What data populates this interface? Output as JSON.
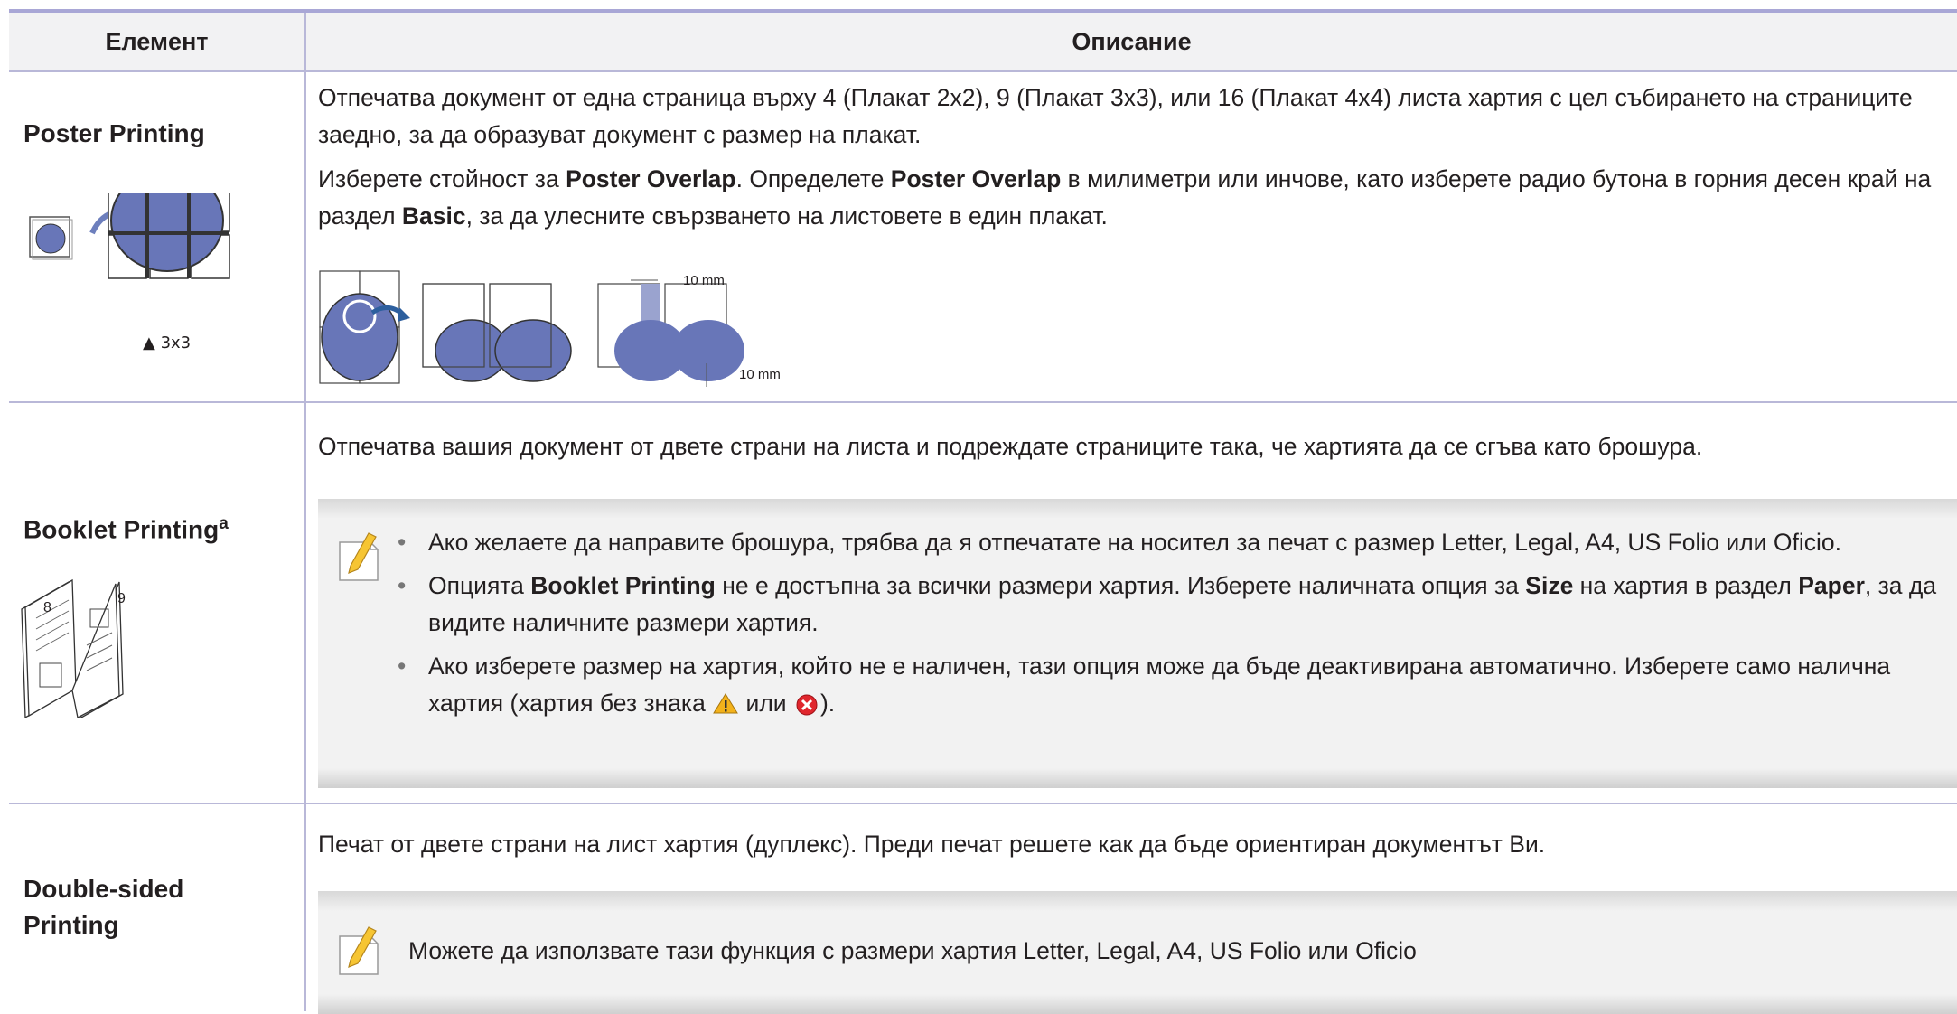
{
  "header": {
    "col1": "Елемент",
    "col2": "Описание"
  },
  "rows": [
    {
      "label": "Poster Printing",
      "illustration_caption": "▲ 3x3",
      "para1": "Отпечатва документ от една страница върху 4 (Плакат 2x2), 9 (Плакат 3x3), или 16 (Плакат 4x4) листа хартия с цел събирането на страниците заедно, за да образуват документ с размер на плакат.",
      "para2_a": "Изберете стойност за ",
      "para2_b": "Poster Overlap",
      "para2_c": ". Определете ",
      "para2_d": "Poster Overlap",
      "para2_e": " в милиметри или инчове, като изберете радио бутона в горния десен край на раздел ",
      "para2_f": "Basic",
      "para2_g": ", за да улесните свързването на листовете в един плакат.",
      "overlap_h": "10 mm",
      "overlap_v": "10 mm"
    },
    {
      "label": "Booklet Printing",
      "label_sup": "a",
      "para1": "Отпечатва вашия документ от двете страни на листа и подреждате страниците така, че хартията да се сгъва като брошура.",
      "bullet1": "Ако желаете да направите брошура, трябва да я отпечатате на носител за печат с размер Letter, Legal, A4, US Folio или Oficio.",
      "bullet2_a": "Опцията ",
      "bullet2_b": "Booklet Printing",
      "bullet2_c": " не е достъпна за всички размери хартия. Изберете наличната опция за ",
      "bullet2_d": "Size",
      "bullet2_e": " на хартия в раздел ",
      "bullet2_f": "Paper",
      "bullet2_g": ", за да видите наличните размери хартия.",
      "bullet3_a": "Ако изберете размер на хартия, който не е наличен, тази опция може да бъде деактивирана автоматично. Изберете само налична хартия (хартия без знака ",
      "bullet3_b": " или ",
      "bullet3_c": ").",
      "book_page_left": "8",
      "book_page_right": "9"
    },
    {
      "label": "Double-sided Printing",
      "para1": "Печат от двете страни на лист хартия (дуплекс). Преди печат решете как да бъде ориентиран документът Ви.",
      "note": "Можете да използвате тази функция с размери хартия Letter, Legal, A4, US Folio или Oficio"
    }
  ],
  "colors": {
    "rule": "#b9b8d8",
    "header_bg": "#f2f2f3",
    "note_bg": "#f2f2f2",
    "apple": "#6876b8"
  }
}
